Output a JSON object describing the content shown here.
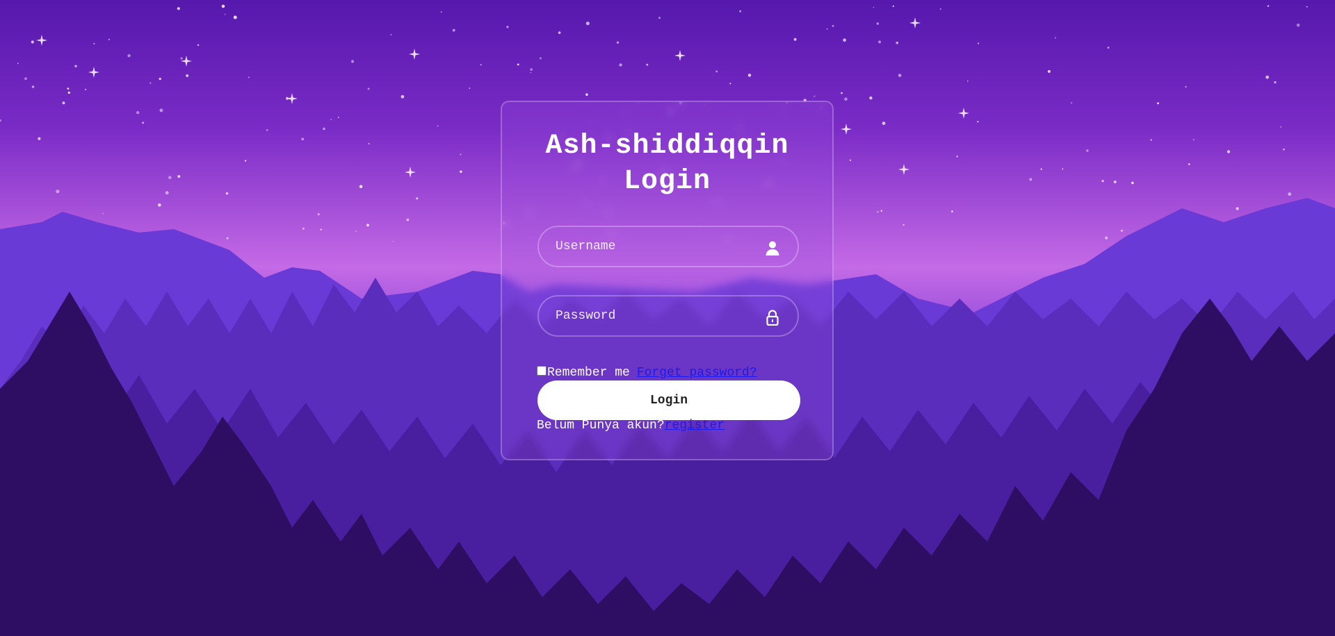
{
  "login_form": {
    "title_line1": "Ash-shiddiqqin",
    "title_line2": "Login",
    "username_placeholder": "Username",
    "username_icon": "user-icon",
    "password_placeholder": "Password",
    "password_icon": "lock-icon",
    "remember_label": "Remember me",
    "forgot_label": "Forget password?",
    "login_button_label": "Login",
    "register_prompt": "Belum Punya akun?",
    "register_link_label": "register"
  },
  "colors": {
    "sky_top": "#5a1ab0",
    "horizon": "#b15ee2",
    "trees_dark": "#2e0e63",
    "link": "#1a1aee",
    "button_bg": "#ffffff"
  }
}
